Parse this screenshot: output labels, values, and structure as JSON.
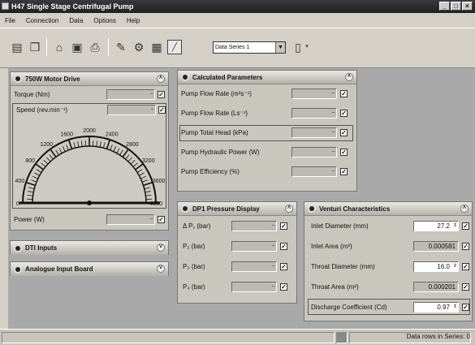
{
  "window": {
    "title": "H47 Single Stage Centrifugal Pump",
    "controls": [
      "_",
      "□",
      "×"
    ]
  },
  "menu": [
    "File",
    "Connection",
    "Data",
    "Options",
    "Help"
  ],
  "toolbar": {
    "series_select": "Data Series 1"
  },
  "motor": {
    "title": "750W Motor Drive",
    "torque_label": "Torque  (Nm)",
    "speed_label": "Speed  (rev.min⁻¹)",
    "power_label": "Power  (W)",
    "gauge_ticks": [
      "0",
      "400",
      "800",
      "1200",
      "1600",
      "2000",
      "2400",
      "2800",
      "3200",
      "3600",
      "4000"
    ],
    "gauge_value": 0,
    "gauge_max": 4000
  },
  "dti": {
    "title": "DTI Inputs"
  },
  "analogue": {
    "title": "Analogue Input Board"
  },
  "calc": {
    "title": "Calculated Parameters",
    "items": [
      "Pump Flow Rate  (m³s⁻¹)",
      "Pump Flow Rate  (Ls⁻¹)",
      "Pump Total Head  (kPa)",
      "Pump Hydraulic Power  (W)",
      "Pump Efficiency  (%)"
    ]
  },
  "dp1": {
    "title": "DP1 Pressure Display",
    "items": [
      "Δ P₁  (bar)",
      "P₂  (bar)",
      "P₃  (bar)",
      "P₄  (bar)"
    ]
  },
  "venturi": {
    "title": "Venturi Characteristics",
    "items": [
      {
        "label": "Inlet Diameter  (mm)",
        "value": "27.2"
      },
      {
        "label": "Inlet Area  (m²)",
        "value": "0.000581"
      },
      {
        "label": "Throat Diameter  (mm)",
        "value": "16.0"
      },
      {
        "label": "Throat Area  (m²)",
        "value": "0.000201"
      },
      {
        "label": "Discharge Coefficient  (Cd)",
        "value": "0.97"
      }
    ]
  },
  "status": {
    "text": "Data rows in Series: 0"
  },
  "colors": {
    "titlebar": "#202020",
    "panel": "#c9c6be",
    "client": "#a9a9a9"
  }
}
